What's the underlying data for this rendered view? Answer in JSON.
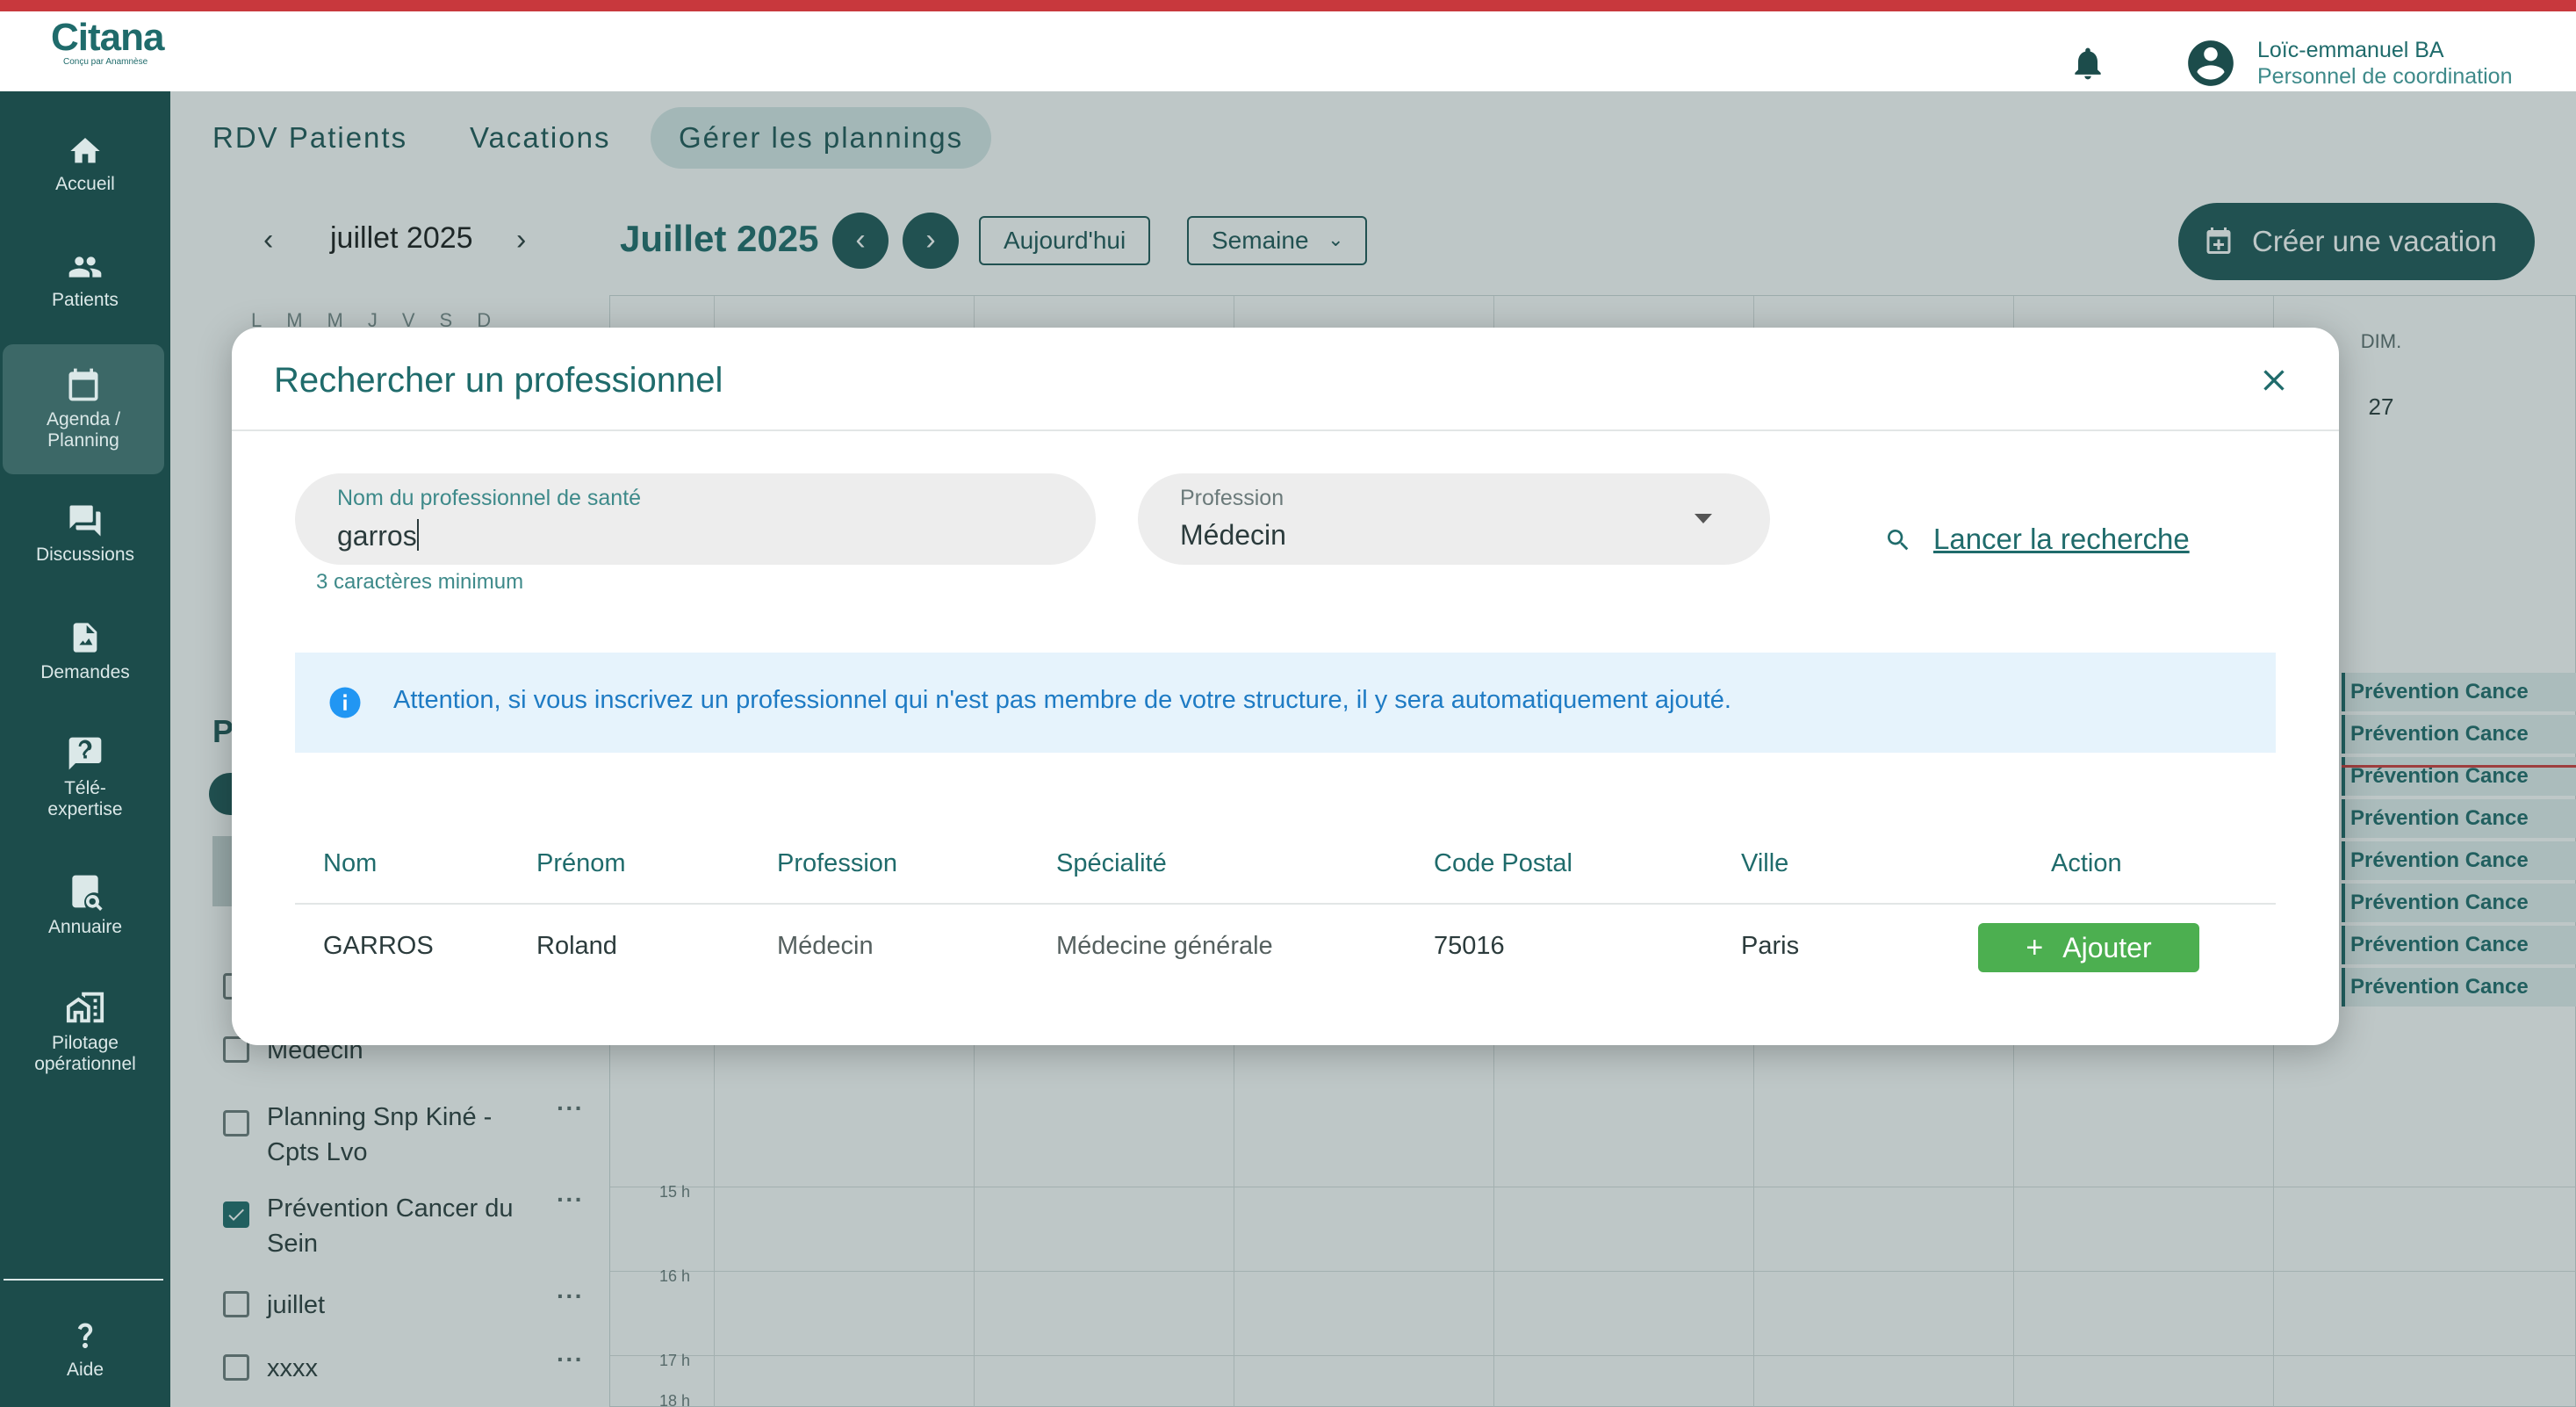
{
  "app": {
    "logo_main": "Citana",
    "logo_sub": "Conçu par Anamnèse"
  },
  "user": {
    "name": "Loïc-emmanuel BA",
    "role": "Personnel de coordination"
  },
  "sidebar": {
    "items": [
      {
        "label": "Accueil",
        "icon": "home-icon"
      },
      {
        "label": "Patients",
        "icon": "people-icon"
      },
      {
        "label": "Agenda / Planning",
        "icon": "calendar-icon",
        "active": true
      },
      {
        "label": "Discussions",
        "icon": "chat-icon"
      },
      {
        "label": "Demandes",
        "icon": "file-icon"
      },
      {
        "label": "Télé-expertise",
        "icon": "question-bubble-icon"
      },
      {
        "label": "Annuaire",
        "icon": "directory-search-icon"
      },
      {
        "label": "Pilotage opérationnel",
        "icon": "buildings-icon"
      }
    ],
    "help_label": "Aide"
  },
  "tabs": [
    {
      "label": "RDV Patients"
    },
    {
      "label": "Vacations"
    },
    {
      "label": "Gérer les plannings",
      "active": true
    }
  ],
  "mini_calendar": {
    "title": "juillet 2025",
    "weekdays": "LMMJVSD"
  },
  "calendar": {
    "title": "Juillet 2025",
    "today_label": "Aujourd'hui",
    "view_label": "Semaine",
    "create_label": "Créer une vacation",
    "day_header": "DIM.",
    "day_number": "27",
    "hours": [
      "15 h",
      "16 h",
      "17 h",
      "18 h"
    ],
    "event_label": "Prévention Cance"
  },
  "plannings": {
    "heading_letter": "P",
    "items": [
      {
        "label": "Médecin",
        "checked": false
      },
      {
        "label": "Planning Snp Kiné - Cpts Lvo",
        "checked": false
      },
      {
        "label": "Prévention Cancer du Sein",
        "checked": true
      },
      {
        "label": "juillet",
        "checked": false
      },
      {
        "label": "xxxx",
        "checked": false
      }
    ],
    "more_label": "···"
  },
  "modal": {
    "title": "Rechercher un professionnel",
    "name_field": {
      "label": "Nom du professionnel de santé",
      "value": "garros",
      "helper": "3 caractères minimum"
    },
    "profession_field": {
      "label": "Profession",
      "value": "Médecin"
    },
    "search_label": "Lancer la recherche",
    "alert_text": "Attention, si vous inscrivez un professionnel qui n'est pas membre de votre structure, il y sera automatiquement ajouté.",
    "table": {
      "headers": [
        "Nom",
        "Prénom",
        "Profession",
        "Spécialité",
        "Code Postal",
        "Ville",
        "Action"
      ],
      "rows": [
        {
          "nom": "GARROS",
          "prenom": "Roland",
          "profession": "Médecin",
          "specialite": "Médecine générale",
          "code_postal": "75016",
          "ville": "Paris",
          "action_label": "Ajouter"
        }
      ]
    }
  },
  "colors": {
    "primary": "#1f5757",
    "accent_bar": "#c8383d",
    "sidebar_bg": "#1c4c4b",
    "success": "#4caf50",
    "info": "#1e7bc4"
  }
}
